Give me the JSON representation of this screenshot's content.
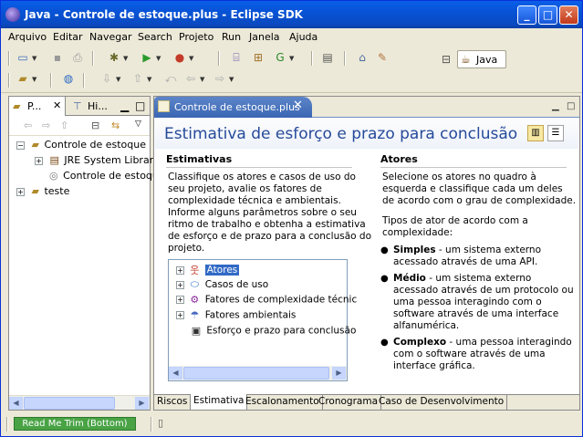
{
  "window": {
    "title": "Java - Controle de estoque.plus - Eclipse SDK"
  },
  "menu": [
    "Arquivo",
    "Editar",
    "Navegar",
    "Search",
    "Projeto",
    "Run",
    "Janela",
    "Ajuda"
  ],
  "perspective": {
    "label": "Java"
  },
  "left_panel": {
    "tabs": [
      "P...",
      "Hi..."
    ],
    "tree": [
      {
        "label": "Controle de estoque",
        "expanded": true
      },
      {
        "label": "JRE System Library"
      },
      {
        "label": "Controle de estoque"
      },
      {
        "label": "teste",
        "expanded": false
      }
    ]
  },
  "editor": {
    "tab_label": "Controle de estoque.plus",
    "form_title": "Estimativa de esforço e prazo para conclusão",
    "estimativas": {
      "heading": "Estimativas",
      "lines": [
        "Classifique os atores e casos de uso do",
        "seu projeto, avalie os fatores de",
        "complexidade técnica e ambientais.",
        "Informe alguns parâmetros sobre o seu",
        "ritmo de trabalho e obtenha a estimativa",
        "de esforço e de prazo para a conclusão do",
        "projeto."
      ],
      "tree": [
        {
          "label": "Atores",
          "selected": true
        },
        {
          "label": "Casos de uso"
        },
        {
          "label": "Fatores de complexidade técnic"
        },
        {
          "label": "Fatores ambientais"
        },
        {
          "label": "Esforço e prazo para conclusão"
        }
      ]
    },
    "atores": {
      "heading": "Atores",
      "intro": [
        "Selecione os atores no quadro à",
        "esquerda e classifique cada um deles",
        "de acordo com o grau de complexidade."
      ],
      "types_intro": [
        "Tipos de ator de acordo com a",
        "complexidade:"
      ],
      "bullets": [
        {
          "term": "Simples",
          "lines": [
            " - um sistema externo",
            "acessado através de uma API."
          ]
        },
        {
          "term": "Médio",
          "lines": [
            " - um sistema externo",
            "acessado através de um protocolo ou",
            "uma pessoa interagindo com o",
            "software através de uma interface",
            "alfanumérica."
          ]
        },
        {
          "term": "Complexo",
          "lines": [
            " - uma pessoa interagindo",
            "com o software através de uma",
            "interface gráfica."
          ]
        }
      ]
    },
    "bottom_tabs": [
      "Riscos",
      "Estimativa",
      "Escalonamento",
      "Cronograma",
      "Caso de Desenvolvimento"
    ],
    "active_bottom_tab": "Estimativa"
  },
  "status": {
    "trim_label": "Read Me Trim (Bottom)"
  }
}
